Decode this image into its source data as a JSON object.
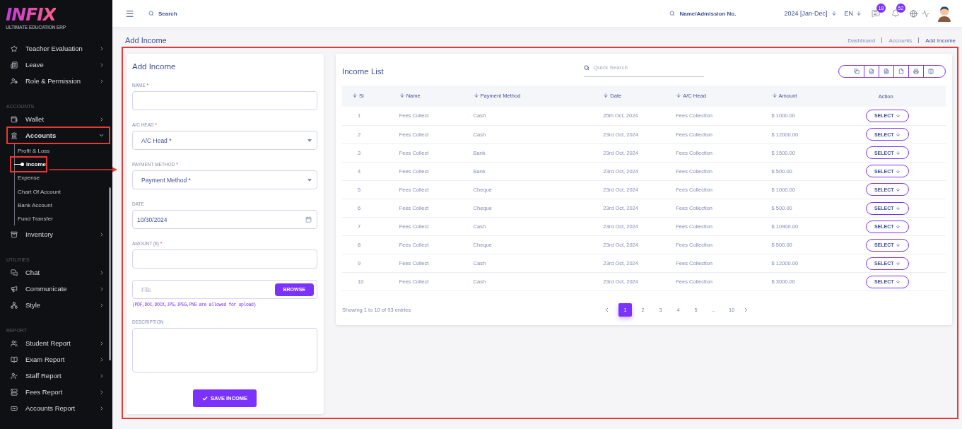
{
  "logo": {
    "name": "INFIX",
    "tagline": "ULTIMATE EDUCATION ERP"
  },
  "sidebar": {
    "sections": [
      {
        "items": [
          {
            "label": "Teacher Evaluation",
            "expanded": false,
            "highlighted": false
          },
          {
            "label": "Leave",
            "expanded": false,
            "highlighted": false
          },
          {
            "label": "Role & Permission",
            "expanded": false,
            "highlighted": false
          }
        ]
      },
      {
        "heading": "ACCOUNTS",
        "items": [
          {
            "label": "Wallet",
            "expanded": false,
            "highlighted": false
          },
          {
            "label": "Accounts",
            "expanded": true,
            "highlighted": true,
            "children": [
              {
                "label": "Profit & Loss",
                "selected": false,
                "highlighted": false
              },
              {
                "label": "Income",
                "selected": true,
                "highlighted": true
              },
              {
                "label": "Expense",
                "selected": false,
                "highlighted": false
              },
              {
                "label": "Chart Of Account",
                "selected": false,
                "highlighted": false
              },
              {
                "label": "Bank Account",
                "selected": false,
                "highlighted": false
              },
              {
                "label": "Fund Transfer",
                "selected": false,
                "highlighted": false
              }
            ]
          },
          {
            "label": "Inventory",
            "expanded": false,
            "highlighted": false
          }
        ]
      },
      {
        "heading": "UTILITIES",
        "items": [
          {
            "label": "Chat",
            "expanded": false,
            "highlighted": false
          },
          {
            "label": "Communicate",
            "expanded": false,
            "highlighted": false
          },
          {
            "label": "Style",
            "expanded": false,
            "highlighted": false
          }
        ]
      },
      {
        "heading": "REPORT",
        "items": [
          {
            "label": "Student Report",
            "expanded": false,
            "highlighted": false
          },
          {
            "label": "Exam Report",
            "expanded": false,
            "highlighted": false
          },
          {
            "label": "Staff Report",
            "expanded": false,
            "highlighted": false
          },
          {
            "label": "Fees Report",
            "expanded": false,
            "highlighted": false
          },
          {
            "label": "Accounts Report",
            "expanded": false,
            "highlighted": false
          }
        ]
      }
    ]
  },
  "topbar": {
    "search": {
      "placeholder": "Search"
    },
    "student_search": {
      "placeholder": "Name/Admission No."
    },
    "session": "2024 [Jan-Dec]",
    "language": "EN",
    "messages_count": "18",
    "notifications_count": "52"
  },
  "page": {
    "title": "Add Income",
    "breadcrumb": [
      "Dashboard",
      "Accounts",
      "Add Income"
    ],
    "highlighted": true
  },
  "form": {
    "title": "Add Income",
    "fields": [
      {
        "kind": "text",
        "label": "NAME",
        "mark": "*"
      },
      {
        "kind": "select",
        "label": "A/C HEAD",
        "mark": "*",
        "placeholder": "A/C Head *"
      },
      {
        "kind": "select",
        "label": "PAYMENT METHOD",
        "mark": "*",
        "placeholder": "Payment Method *"
      },
      {
        "kind": "date",
        "label": "DATE",
        "value": "10/30/2024"
      },
      {
        "kind": "text",
        "label": "AMOUNT ($)",
        "mark": "*"
      },
      {
        "kind": "file",
        "placeholder": "File",
        "button": "BROWSE",
        "note": "(PDF,DOC,DOCX,JPG,JPEG,PNG are allowed for upload)"
      },
      {
        "kind": "textarea",
        "label": "DESCRIPTION"
      }
    ],
    "submit": "SAVE INCOME"
  },
  "income_list": {
    "title": "Income List",
    "search": {
      "placeholder": "Quick Search"
    },
    "columns": [
      "Si",
      "Name",
      "Payment Method",
      "Date",
      "A/C Head",
      "Amount",
      "Action"
    ],
    "rows": [
      {
        "cells": [
          "1",
          "Fees Collect",
          "Cash",
          "25th Oct, 2024",
          "Fees Collection",
          "$ 1000.00"
        ],
        "action": "SELECT"
      },
      {
        "cells": [
          "2",
          "Fees Collect",
          "Cash",
          "23rd Oct, 2024",
          "Fees Collection",
          "$ 12000.00"
        ],
        "action": "SELECT"
      },
      {
        "cells": [
          "3",
          "Fees Collect",
          "Bank",
          "23rd Oct, 2024",
          "Fees Collection",
          "$ 1500.00"
        ],
        "action": "SELECT"
      },
      {
        "cells": [
          "4",
          "Fees Collect",
          "Bank",
          "23rd Oct, 2024",
          "Fees Collection",
          "$ 500.00"
        ],
        "action": "SELECT"
      },
      {
        "cells": [
          "5",
          "Fees Collect",
          "Cheque",
          "23rd Oct, 2024",
          "Fees Collection",
          "$ 1000.00"
        ],
        "action": "SELECT"
      },
      {
        "cells": [
          "6",
          "Fees Collect",
          "Cheque",
          "23rd Oct, 2024",
          "Fees Collection",
          "$ 500.00"
        ],
        "action": "SELECT"
      },
      {
        "cells": [
          "7",
          "Fees Collect",
          "Cash",
          "23rd Oct, 2024",
          "Fees Collection",
          "$ 10900.00"
        ],
        "action": "SELECT"
      },
      {
        "cells": [
          "8",
          "Fees Collect",
          "Cheque",
          "23rd Oct, 2024",
          "Fees Collection",
          "$ 500.00"
        ],
        "action": "SELECT"
      },
      {
        "cells": [
          "9",
          "Fees Collect",
          "Cash",
          "23rd Oct, 2024",
          "Fees Collection",
          "$ 12000.00"
        ],
        "action": "SELECT"
      },
      {
        "cells": [
          "10",
          "Fees Collect",
          "Cash",
          "23rd Oct, 2024",
          "Fees Collection",
          "$ 3000.00"
        ],
        "action": "SELECT"
      }
    ],
    "summary": "Showing 1 to 10 of 93 entries",
    "pages": [
      {
        "label": "1",
        "selected": true
      },
      {
        "label": "2",
        "selected": false
      },
      {
        "label": "3",
        "selected": false
      },
      {
        "label": "4",
        "selected": false
      },
      {
        "label": "5",
        "selected": false
      },
      {
        "label": "...",
        "selected": false
      },
      {
        "label": "10",
        "selected": false
      }
    ]
  }
}
